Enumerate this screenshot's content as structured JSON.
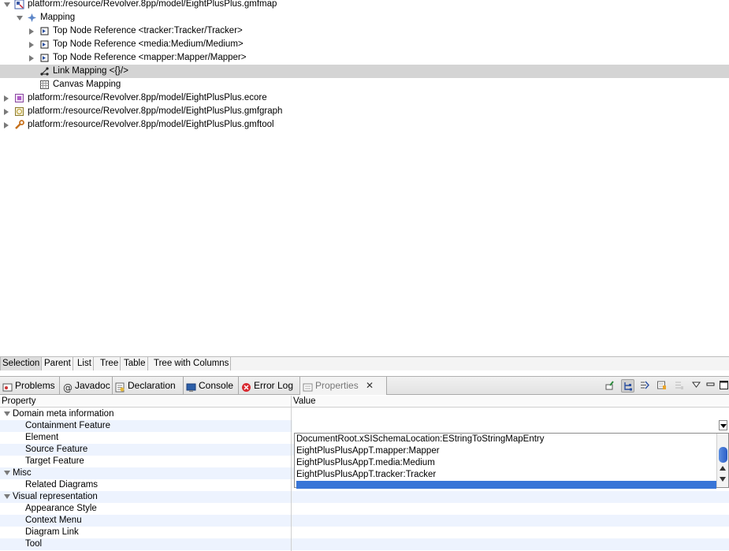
{
  "tree": {
    "items": [
      {
        "label": "platform:/resource/Revolver.8pp/model/EightPlusPlus.gmfmap",
        "icon": "gmfmap-file-icon",
        "toggle": "down"
      },
      {
        "label": "Mapping",
        "icon": "mapping-icon",
        "toggle": "down"
      },
      {
        "label": "Top Node Reference <tracker:Tracker/Tracker>",
        "icon": "top-node-reference-icon",
        "toggle": "right"
      },
      {
        "label": "Top Node Reference <media:Medium/Medium>",
        "icon": "top-node-reference-icon",
        "toggle": "right"
      },
      {
        "label": "Top Node Reference <mapper:Mapper/Mapper>",
        "icon": "top-node-reference-icon",
        "toggle": "right"
      },
      {
        "label": "Link Mapping <{}/>",
        "icon": "link-mapping-icon",
        "toggle": "none",
        "selected": true
      },
      {
        "label": "Canvas Mapping",
        "icon": "canvas-mapping-icon",
        "toggle": "none"
      },
      {
        "label": "platform:/resource/Revolver.8pp/model/EightPlusPlus.ecore",
        "icon": "ecore-file-icon",
        "toggle": "right"
      },
      {
        "label": "platform:/resource/Revolver.8pp/model/EightPlusPlus.gmfgraph",
        "icon": "gmfgraph-file-icon",
        "toggle": "right"
      },
      {
        "label": "platform:/resource/Revolver.8pp/model/EightPlusPlus.gmftool",
        "icon": "gmftool-file-icon",
        "toggle": "right"
      }
    ]
  },
  "selection_tabs": [
    "Selection",
    "Parent",
    "List",
    "Tree",
    "Table",
    "Tree with Columns"
  ],
  "view_tabs": [
    {
      "label": "Problems",
      "icon": "problems-icon"
    },
    {
      "label": "Javadoc",
      "icon": "javadoc-icon"
    },
    {
      "label": "Declaration",
      "icon": "declaration-icon"
    },
    {
      "label": "Console",
      "icon": "console-icon"
    },
    {
      "label": "Error Log",
      "icon": "error-log-icon"
    },
    {
      "label": "Properties",
      "icon": "properties-icon",
      "active": true
    }
  ],
  "view_toolbar": [
    "pin-icon",
    "show-categories-icon",
    "show-advanced-icon",
    "filter-icon",
    "restore-default-icon",
    "view-menu-icon",
    "minimize-icon",
    "maximize-icon"
  ],
  "properties": {
    "header_property": "Property",
    "header_value": "Value",
    "rows": [
      {
        "label": "Domain meta information",
        "level": 0
      },
      {
        "label": "Containment Feature",
        "level": 1
      },
      {
        "label": "Element",
        "level": 1
      },
      {
        "label": "Source Feature",
        "level": 1
      },
      {
        "label": "Target Feature",
        "level": 1
      },
      {
        "label": "Misc",
        "level": 0
      },
      {
        "label": "Related Diagrams",
        "level": 1
      },
      {
        "label": "Visual representation",
        "level": 0
      },
      {
        "label": "Appearance Style",
        "level": 1
      },
      {
        "label": "Context Menu",
        "level": 1
      },
      {
        "label": "Diagram Link",
        "level": 1
      },
      {
        "label": "Tool",
        "level": 1
      }
    ]
  },
  "dropdown": {
    "value": "",
    "options": [
      "DocumentRoot.xSISchemaLocation:EStringToStringMapEntry",
      "EightPlusPlusAppT.mapper:Mapper",
      "EightPlusPlusAppT.media:Medium",
      "EightPlusPlusAppT.tracker:Tracker",
      ""
    ],
    "selected_index": 4
  },
  "colors": {
    "selection_blue": "#3875d7",
    "tree_selected": "#d4d4d4",
    "alt_row": "#edf3fe"
  }
}
